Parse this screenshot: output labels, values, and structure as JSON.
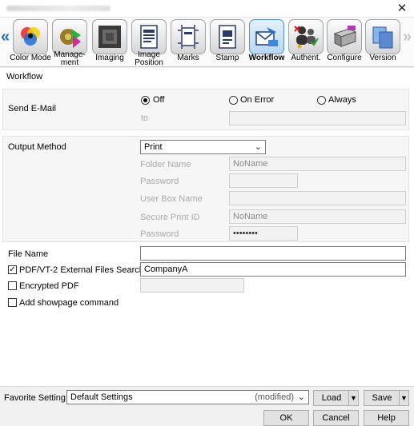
{
  "window": {
    "close_glyph": "✕"
  },
  "toolbar": {
    "left_arrow": "«",
    "right_arrow": "»",
    "items": [
      {
        "label": "Color Mode",
        "icon": "color-circles-icon"
      },
      {
        "label": "Manage-\nment",
        "icon": "gear-play-icon"
      },
      {
        "label": "Imaging",
        "icon": "imaging-icon"
      },
      {
        "label": "Image\nPosition",
        "icon": "document-position-icon"
      },
      {
        "label": "Marks",
        "icon": "crop-marks-icon"
      },
      {
        "label": "Stamp",
        "icon": "stamp-icon"
      },
      {
        "label": "Workflow",
        "icon": "workflow-envelope-icon",
        "selected": true
      },
      {
        "label": "Authent.",
        "icon": "users-key-icon"
      },
      {
        "label": "Configure",
        "icon": "printer-configure-icon"
      },
      {
        "label": "Version",
        "icon": "version-icon"
      }
    ]
  },
  "panel": {
    "title": "Workflow",
    "send_email": {
      "label": "Send E-Mail",
      "options": [
        "Off",
        "On Error",
        "Always"
      ],
      "selected": "Off",
      "to_label": "to",
      "to_value": ""
    },
    "output": {
      "label": "Output Method",
      "method_value": "Print",
      "folder_name_label": "Folder Name",
      "folder_name_value": "NoName",
      "password_label": "Password",
      "user_box_label": "User Box Name",
      "secure_print_label": "Secure Print ID",
      "secure_print_value": "NoName",
      "password2_label": "Password",
      "password2_value": "••••••••"
    },
    "file_name": {
      "label": "File Name",
      "value": ""
    },
    "pdf_search": {
      "label": "PDF/VT-2 External Files Search",
      "checked": true,
      "value": "CompanyA"
    },
    "encrypted_pdf": {
      "label": "Encrypted PDF",
      "checked": false
    },
    "showpage": {
      "label": "Add showpage command",
      "checked": false
    }
  },
  "footer": {
    "favorite_label": "Favorite Setting",
    "favorite_value": "Default Settings",
    "favorite_suffix": "(modified)",
    "load_label": "Load",
    "save_label": "Save",
    "ok_label": "OK",
    "cancel_label": "Cancel",
    "help_label": "Help"
  },
  "colors": {
    "accent": "#1a6fc7",
    "selected_bg": "#cfe4f7"
  }
}
